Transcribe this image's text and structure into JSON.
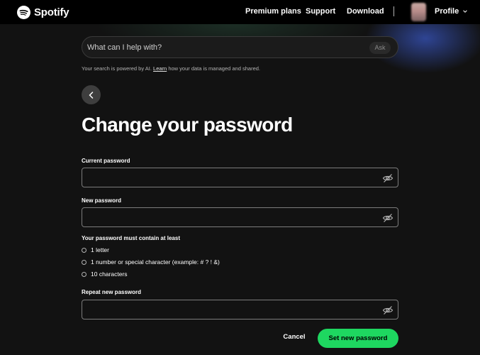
{
  "nav": {
    "brand": "Spotify",
    "links": {
      "premium": "Premium plans",
      "support": "Support",
      "download": "Download"
    },
    "profile": "Profile"
  },
  "search": {
    "placeholder": "What can I help with?",
    "ask": "Ask",
    "note_prefix": "Your search is powered by AI.",
    "note_link": "Learn",
    "note_suffix": "how your data is managed and shared."
  },
  "page": {
    "title": "Change your password"
  },
  "form": {
    "current_label": "Current password",
    "new_label": "New password",
    "requirements_title": "Your password must contain at least",
    "requirements": [
      "1 letter",
      "1 number or special character (example: # ? ! &)",
      "10 characters"
    ],
    "repeat_label": "Repeat new password",
    "cancel": "Cancel",
    "submit": "Set new password"
  },
  "colors": {
    "accent": "#1ed760",
    "background": "#121212",
    "nav": "#000000"
  },
  "icons": {
    "logo": "spotify-logo-icon",
    "back": "chevron-left-icon",
    "eye": "eye-off-icon",
    "chevron": "chevron-down-icon"
  }
}
